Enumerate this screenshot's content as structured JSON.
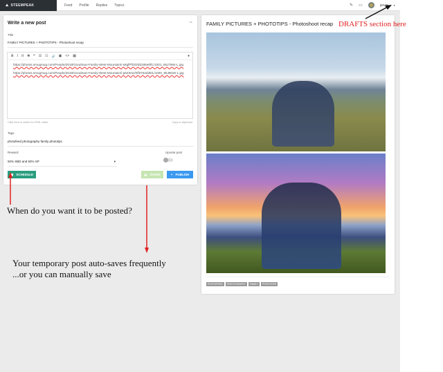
{
  "header": {
    "logo": "STEEMPEAK",
    "nav": [
      "Feed",
      "Profile",
      "Replies",
      "Topics"
    ],
    "user": "jarvie"
  },
  "editor": {
    "heading": "Write a new post",
    "menu_icon": "more-icon",
    "title_label": "Title",
    "title_value": "FAMILY PICTURES + PHOTOTIPS - Photoshoot recap",
    "toolbar": [
      "B",
      "I",
      "H",
      "S",
      "❝",
      "☰",
      "☷",
      "🔗",
      "▣",
      "<>",
      "▦"
    ],
    "body": [
      "https://photos.smugmug.com/People/2018/Goodman-Family-West-Mountain/i-s6gfPfS/0/dd186e8f/L/1001_85J7964-L.jpg",
      "https://photos.smugmug.com/People/2018/Goodman-Family-West-Mountain/i-p6Z3rsz/0/f6762dd8/L/1000_85J8026-L.jpg"
    ],
    "html_switch": "Click here to switch to HTML editor",
    "copy": "Copy to clipboard",
    "tags_label": "Tags",
    "tags_value": "photofeed photography family phototips",
    "reward_label": "Reward",
    "reward_value": "50% SBD and 50% SP",
    "upvote_label": "Upvote post",
    "upvote_on": false,
    "schedule": "SCHEDULE",
    "saved": "SAVED",
    "publish": "PUBLISH"
  },
  "preview": {
    "title": "FAMILY PICTURES + PHOTOTIPS - Photoshoot recap",
    "tags": [
      "PHOTOFEED",
      "PHOTOGRAPHY",
      "FAMILY",
      "PHOTOTIPS"
    ]
  },
  "annotations": {
    "drafts": "DRAFTS section here",
    "schedule": "When do you want it to be posted?",
    "save1": "Your temporary post auto-saves frequently",
    "save2": "...or you can manually save"
  },
  "colors": {
    "schedule": "#2a9d7f",
    "saved": "#c6e5b1",
    "publish": "#3b99f0",
    "annotation_red": "#e02020"
  }
}
